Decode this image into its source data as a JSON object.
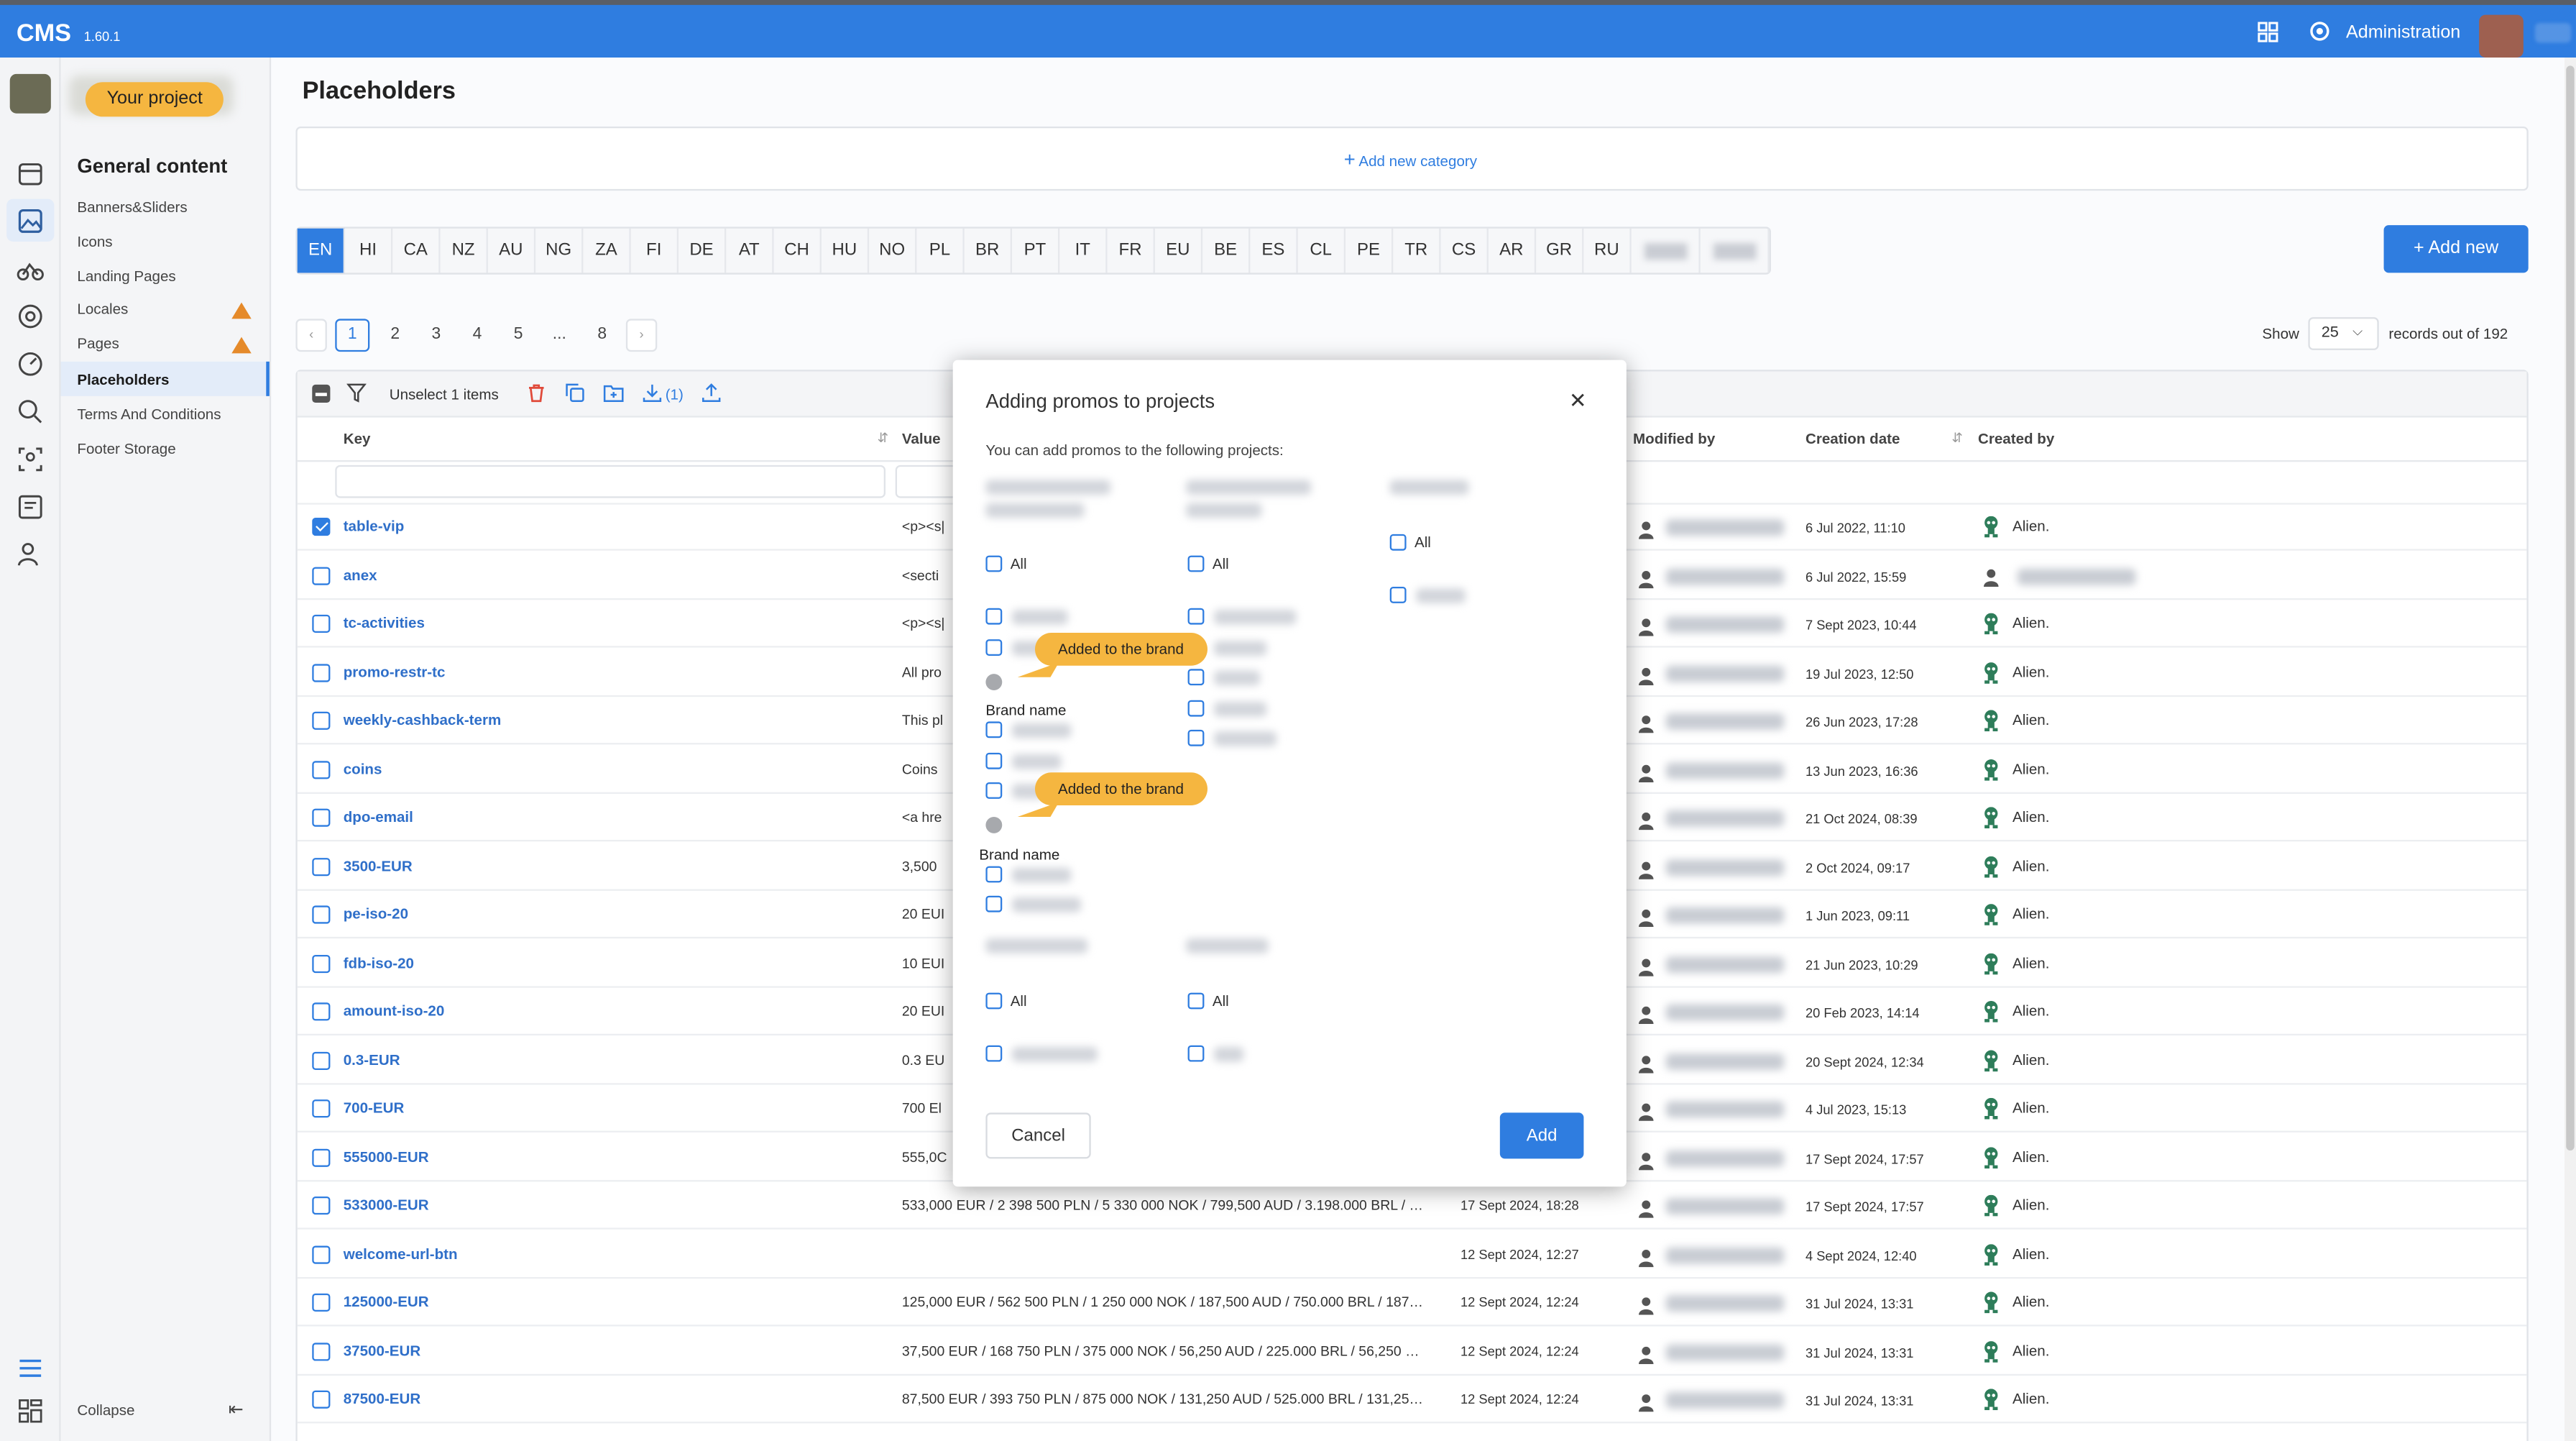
{
  "app": {
    "brand": "CMS",
    "version": "1.60.1",
    "admin_label": "Administration"
  },
  "project": {
    "label": "Your project"
  },
  "nav": {
    "heading": "General content",
    "items": [
      {
        "label": "Banners&Sliders",
        "warn": false
      },
      {
        "label": "Icons",
        "warn": false
      },
      {
        "label": "Landing Pages",
        "warn": false
      },
      {
        "label": "Locales",
        "warn": true
      },
      {
        "label": "Pages",
        "warn": true
      },
      {
        "label": "Placeholders",
        "warn": false,
        "active": true
      },
      {
        "label": "Terms And Conditions",
        "warn": false
      },
      {
        "label": "Footer Storage",
        "warn": false
      }
    ],
    "collapse_label": "Collapse"
  },
  "page": {
    "title": "Placeholders",
    "add_category": "Add new category",
    "add_new": "Add new"
  },
  "languages": [
    "EN",
    "HI",
    "CA",
    "NZ",
    "AU",
    "NG",
    "ZA",
    "FI",
    "DE",
    "AT",
    "CH",
    "HU",
    "NO",
    "PL",
    "BR",
    "PT",
    "IT",
    "FR",
    "EU",
    "BE",
    "ES",
    "CL",
    "PE",
    "TR",
    "CS",
    "AR",
    "GR",
    "RU"
  ],
  "active_language": "EN",
  "pagination": {
    "pages": [
      "1",
      "2",
      "3",
      "4",
      "5",
      "...",
      "8"
    ],
    "current": "1",
    "prev": "‹",
    "next": "›"
  },
  "records": {
    "show_label": "Show",
    "per_page": "25",
    "total_text": "records out of 192"
  },
  "toolbar": {
    "unselect_label": "Unselect 1 items",
    "move_count": "(1)"
  },
  "table": {
    "headers": {
      "key": "Key",
      "value": "Value",
      "modified_by": "Modified by",
      "creation_date": "Creation date",
      "created_by": "Created by"
    },
    "rows": [
      {
        "key": "table-vip",
        "value": "<p><s|",
        "mdate": "",
        "cdate": "6 Jul 2022, 11:10",
        "created": "Alien.",
        "checked": true
      },
      {
        "key": "anex",
        "value": "<secti",
        "mdate": "",
        "cdate": "6 Jul 2022, 15:59",
        "created": "",
        "checked": false
      },
      {
        "key": "tc-activities",
        "value": "<p><s|",
        "mdate": "",
        "cdate": "7 Sept 2023, 10:44",
        "created": "Alien.",
        "checked": false
      },
      {
        "key": "promo-restr-tc",
        "value": "All pro",
        "mdate": "",
        "cdate": "19 Jul 2023, 12:50",
        "created": "Alien.",
        "checked": false
      },
      {
        "key": "weekly-cashback-term",
        "value": "This pl",
        "mdate": "",
        "cdate": "26 Jun 2023, 17:28",
        "created": "Alien.",
        "checked": false
      },
      {
        "key": "coins",
        "value": "Coins",
        "mdate": "",
        "cdate": "13 Jun 2023, 16:36",
        "created": "Alien.",
        "checked": false
      },
      {
        "key": "dpo-email",
        "value": "<a hre",
        "mdate": "",
        "cdate": "21 Oct 2024, 08:39",
        "created": "Alien.",
        "checked": false
      },
      {
        "key": "3500-EUR",
        "value": "3,500",
        "mdate": "",
        "cdate": "2 Oct 2024, 09:17",
        "created": "Alien.",
        "checked": false
      },
      {
        "key": "pe-iso-20",
        "value": "20 EUI",
        "mdate": "",
        "cdate": "1 Jun 2023, 09:11",
        "created": "Alien.",
        "checked": false
      },
      {
        "key": "fdb-iso-20",
        "value": "10 EUI",
        "mdate": "",
        "cdate": "21 Jun 2023, 10:29",
        "created": "Alien.",
        "checked": false
      },
      {
        "key": "amount-iso-20",
        "value": "20 EUI",
        "mdate": "",
        "cdate": "20 Feb 2023, 14:14",
        "created": "Alien.",
        "checked": false
      },
      {
        "key": "0.3-EUR",
        "value": "0.3 EU",
        "mdate": "",
        "cdate": "20 Sept 2024, 12:34",
        "created": "Alien.",
        "checked": false
      },
      {
        "key": "700-EUR",
        "value": "700 El",
        "mdate": "",
        "cdate": "4 Jul 2023, 15:13",
        "created": "Alien.",
        "checked": false
      },
      {
        "key": "555000-EUR",
        "value": "555,0C",
        "mdate": "",
        "cdate": "17 Sept 2024, 17:57",
        "created": "Alien.",
        "checked": false
      },
      {
        "key": "533000-EUR",
        "value": "533,000 EUR / 2 398 500 PLN / 5 330 000 NOK / 799,500 AUD / 3.198.000 BRL / …",
        "mdate": "17 Sept 2024, 18:28",
        "cdate": "17 Sept 2024, 17:57",
        "created": "Alien.",
        "checked": false
      },
      {
        "key": "welcome-url-btn",
        "value": "",
        "mdate": "12 Sept 2024, 12:27",
        "cdate": "4 Sept 2024, 12:40",
        "created": "Alien.",
        "checked": false
      },
      {
        "key": "125000-EUR",
        "value": "125,000 EUR / 562 500 PLN / 1 250 000 NOK / 187,500 AUD / 750.000 BRL / 187…",
        "mdate": "12 Sept 2024, 12:24",
        "cdate": "31 Jul 2024, 13:31",
        "created": "Alien.",
        "checked": false
      },
      {
        "key": "37500-EUR",
        "value": "37,500 EUR / 168 750 PLN / 375 000 NOK / 56,250 AUD / 225.000 BRL / 56,250 …",
        "mdate": "12 Sept 2024, 12:24",
        "cdate": "31 Jul 2024, 13:31",
        "created": "Alien.",
        "checked": false
      },
      {
        "key": "87500-EUR",
        "value": "87,500 EUR / 393 750 PLN / 875 000 NOK / 131,250 AUD / 525.000 BRL / 131,25…",
        "mdate": "12 Sept 2024, 12:24",
        "cdate": "31 Jul 2024, 13:31",
        "created": "Alien.",
        "checked": false
      }
    ]
  },
  "modal": {
    "title": "Adding promos to projects",
    "subtitle": "You can add promos to the following projects:",
    "all_label": "All",
    "tooltip": "Added to the brand",
    "brand_name": "Brand name",
    "cancel": "Cancel",
    "add": "Add"
  },
  "colors": {
    "accent": "#2f7de0",
    "highlight": "#f5b640",
    "warning": "#e58a2a"
  }
}
